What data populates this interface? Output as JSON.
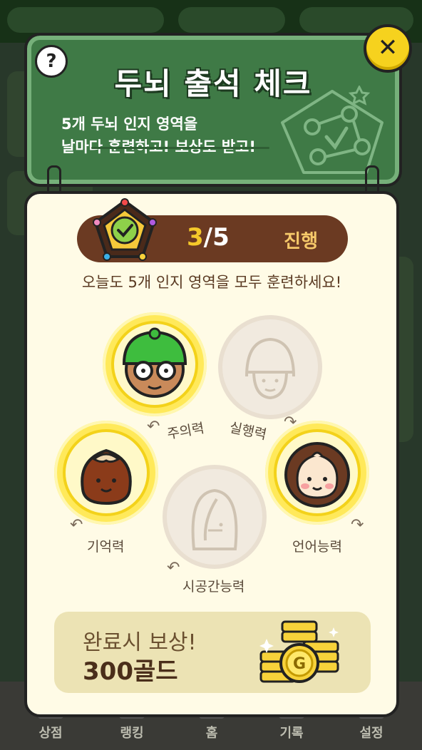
{
  "header": {
    "title": "두뇌 출석 체크",
    "description_line1": "5개 두뇌 인지 영역을",
    "description_line2": "날마다 훈련하고! 보상도 받고!",
    "help_symbol": "?",
    "close_symbol": "✕"
  },
  "progress": {
    "done": "3",
    "total": "/5",
    "status": "진행",
    "value": 0.6
  },
  "instruction": "오늘도 5개 인지 영역을 모두 훈련하세요!",
  "domains": [
    {
      "label": "주의력",
      "completed": true
    },
    {
      "label": "실행력",
      "completed": false
    },
    {
      "label": "기억력",
      "completed": true
    },
    {
      "label": "언어능력",
      "completed": true
    },
    {
      "label": "시공간능력",
      "completed": false
    }
  ],
  "reward": {
    "title": "완료시 보상!",
    "amount": "300골드"
  },
  "bottom_nav": [
    "상점",
    "랭킹",
    "홈",
    "기록",
    "설정"
  ],
  "colors": {
    "board_green": "#3f7a46",
    "close_yellow": "#f6d21e",
    "progress_brown": "#6b3a22",
    "active_yellow": "#ffe95a"
  }
}
